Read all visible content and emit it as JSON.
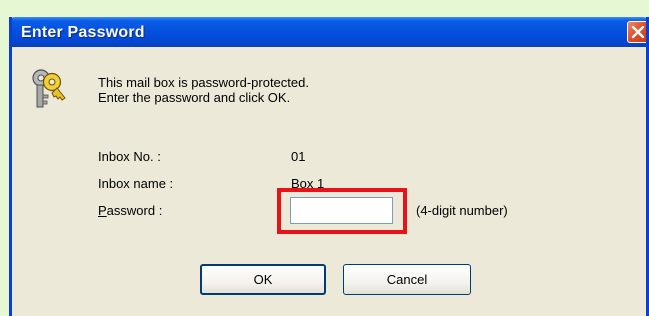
{
  "window": {
    "title": "Enter Password"
  },
  "message": {
    "line1": "This mail box is password-protected.",
    "line2": "Enter the password and click OK."
  },
  "fields": {
    "inbox_no_label": "Inbox No. :",
    "inbox_no_value": "01",
    "inbox_name_label": "Inbox name :",
    "inbox_name_value": "Box 1",
    "password_label_first": "P",
    "password_label_rest": "assword :",
    "password_value": "",
    "password_hint": "(4-digit number)"
  },
  "buttons": {
    "ok_label": "OK",
    "cancel_label": "Cancel"
  },
  "icons": {
    "close": "close-icon",
    "keys": "keys-icon"
  },
  "colors": {
    "titlebar": "#0451de",
    "highlight": "#e8121a",
    "dialog_bg": "#ece9d8"
  }
}
